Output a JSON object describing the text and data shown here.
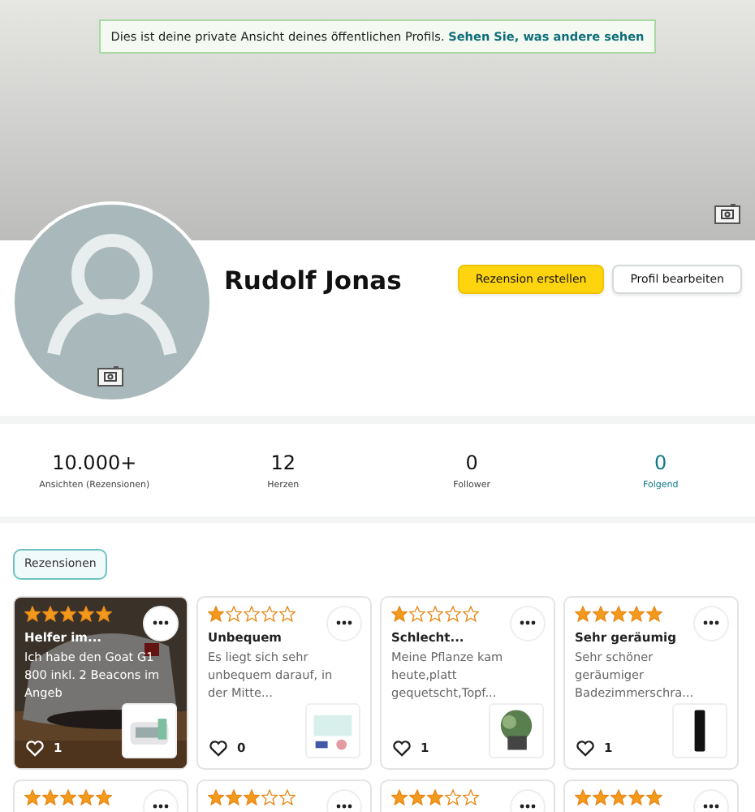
{
  "notice": {
    "text": "Dies ist deine private Ansicht deines öffentlichen Profils.",
    "link": "Sehen Sie, was andere sehen"
  },
  "profile": {
    "name": "Rudolf Jonas",
    "buttons": [
      {
        "label": "Rezension erstellen",
        "kind": "primary"
      },
      {
        "label": "Profil bearbeiten",
        "kind": "secondary"
      }
    ]
  },
  "stats": [
    {
      "value": "10.000+",
      "label": "Ansichten (Rezensionen)",
      "link": false
    },
    {
      "value": "12",
      "label": "Herzen",
      "link": false
    },
    {
      "value": "0",
      "label": "Follower",
      "link": false
    },
    {
      "value": "0",
      "label": "Folgend",
      "link": true
    }
  ],
  "tabs": [
    {
      "label": "Rezensionen",
      "selected": true
    }
  ],
  "reviews": [
    {
      "stars": 5,
      "title": "Helfer im...",
      "text": "Ich habe den Goat G1 800 inkl. 2 Beacons im Angeb",
      "hearts": "1"
    },
    {
      "kind": "plain",
      "stars": 1,
      "title": "Unbequem",
      "text": "Es liegt sich sehr unbequem darauf, in der Mitte...",
      "hearts": "0"
    },
    {
      "kind": "plain",
      "stars": 1,
      "title": "Schlecht...",
      "text": "Meine Pflanze kam heute,platt gequetscht,Topf...",
      "hearts": "1"
    },
    {
      "kind": "plain",
      "stars": 5,
      "title": "Sehr geräumig",
      "text": "Sehr schöner geräumiger Badezimmerschra...",
      "hearts": "1"
    },
    {
      "kind": "plain",
      "stars": 5
    },
    {
      "kind": "plain",
      "stars": 3
    },
    {
      "kind": "plain",
      "stars": 3
    },
    {
      "kind": "plain",
      "stars": 5
    }
  ]
}
